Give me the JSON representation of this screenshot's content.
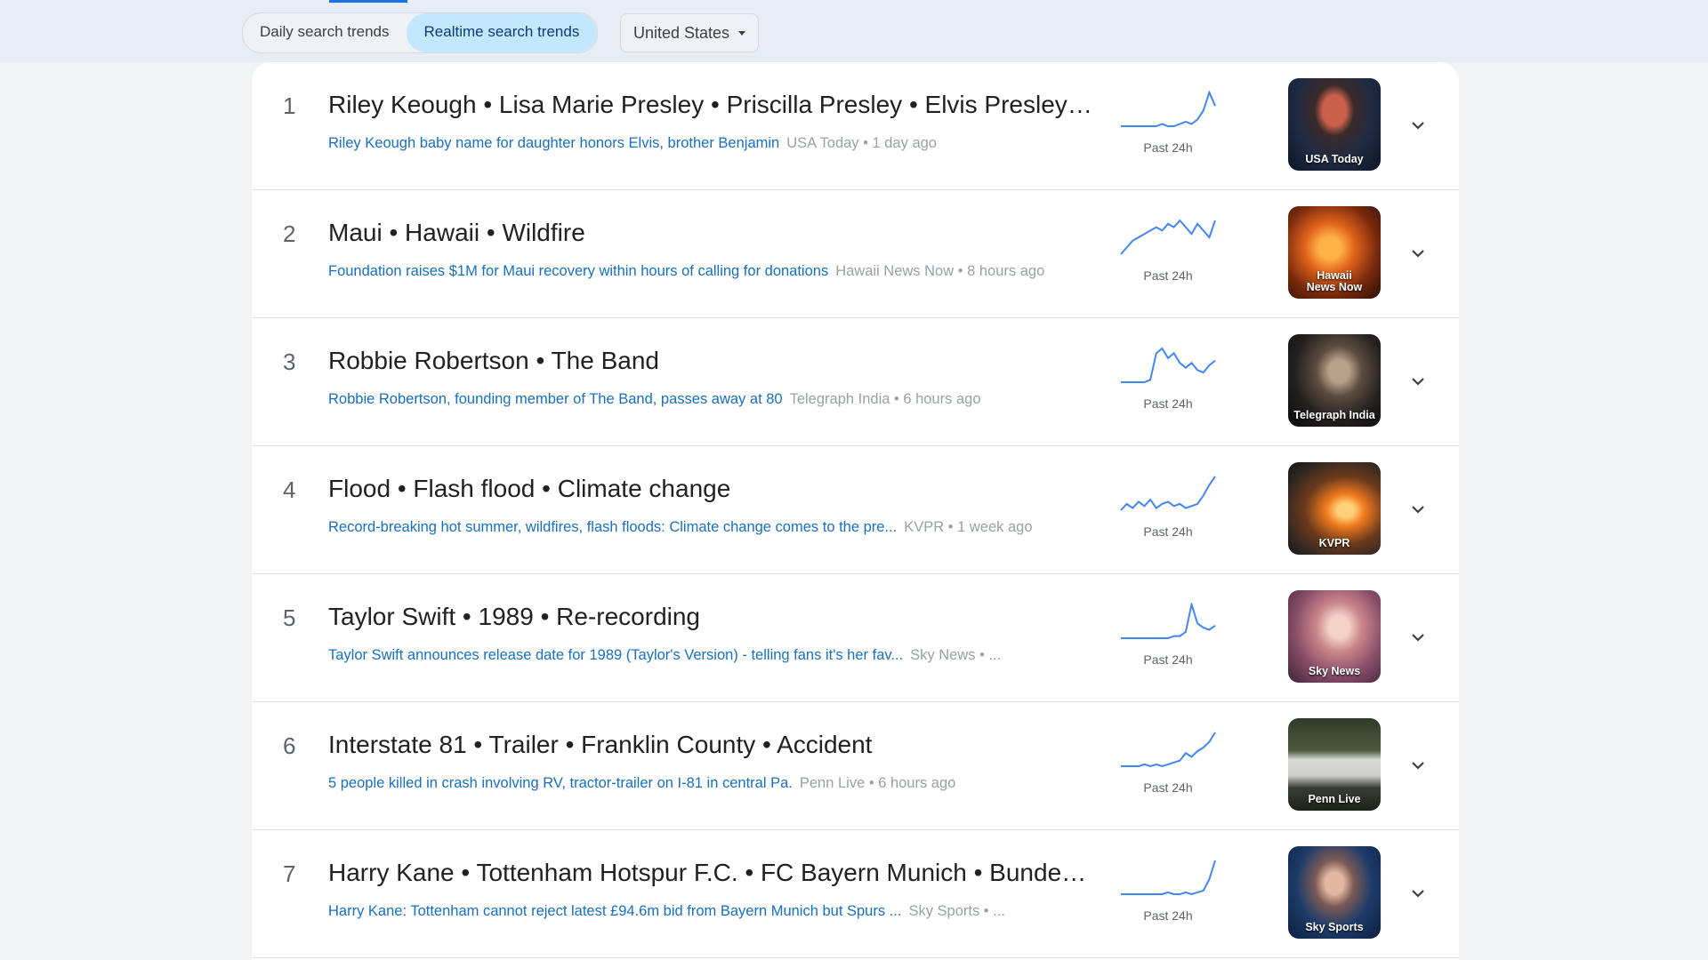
{
  "header": {
    "tabs": [
      {
        "label": "Daily search trends"
      },
      {
        "label": "Realtime search trends"
      }
    ],
    "country": "United States"
  },
  "trends": [
    {
      "rank": "1",
      "title": "Riley Keough • Lisa Marie Presley • Priscilla Presley • Elvis Presley • Graceland",
      "headline": "Riley Keough baby name for daughter honors Elvis, brother Benjamin",
      "meta": "USA Today • 1 day ago",
      "period": "Past 24h",
      "source": "USA Today",
      "trend": [
        3,
        3,
        3,
        3,
        3,
        3,
        3,
        4,
        3,
        3,
        4,
        5,
        4,
        6,
        10,
        18,
        12
      ]
    },
    {
      "rank": "2",
      "title": "Maui • Hawaii • Wildfire",
      "headline": "Foundation raises $1M for Maui recovery within hours of calling for donations",
      "meta": "Hawaii News Now • 8 hours ago",
      "period": "Past 24h",
      "source": "Hawaii News Now",
      "trend": [
        4,
        6,
        8,
        9,
        10,
        11,
        12,
        11,
        13,
        12,
        14,
        12,
        10,
        13,
        11,
        9,
        14
      ]
    },
    {
      "rank": "3",
      "title": "Robbie Robertson • The Band",
      "headline": "Robbie Robertson, founding member of The Band, passes away at 80",
      "meta": "Telegraph India • 6 hours ago",
      "period": "Past 24h",
      "source": "Telegraph India",
      "trend": [
        1,
        1,
        1,
        1,
        1,
        2,
        13,
        15,
        11,
        13,
        9,
        7,
        9,
        6,
        5,
        8,
        10
      ]
    },
    {
      "rank": "4",
      "title": "Flood • Flash flood • Climate change",
      "headline": "Record-breaking hot summer, wildfires, flash floods: Climate change comes to the pre...",
      "meta": "KVPR • 1 week ago",
      "period": "Past 24h",
      "source": "KVPR",
      "trend": [
        3,
        6,
        4,
        7,
        5,
        8,
        4,
        6,
        7,
        5,
        6,
        4,
        5,
        6,
        10,
        15,
        19
      ]
    },
    {
      "rank": "5",
      "title": "Taylor Swift • 1989 • Re-recording",
      "headline": "Taylor Swift announces release date for 1989 (Taylor's Version) - telling fans it's her fav...",
      "meta": "Sky News • ...",
      "period": "Past 24h",
      "source": "Sky News",
      "trend": [
        1,
        1,
        1,
        1,
        1,
        1,
        1,
        1,
        1,
        2,
        2,
        4,
        17,
        8,
        6,
        5,
        7
      ]
    },
    {
      "rank": "6",
      "title": "Interstate 81 • Trailer • Franklin County • Accident",
      "headline": "5 people killed in crash involving RV, tractor-trailer on I-81 in central Pa.",
      "meta": "Penn Live • 6 hours ago",
      "period": "Past 24h",
      "source": "Penn Live",
      "trend": [
        2,
        2,
        2,
        2,
        3,
        2,
        3,
        2,
        3,
        4,
        5,
        9,
        7,
        10,
        12,
        15,
        20
      ]
    },
    {
      "rank": "7",
      "title": "Harry Kane • Tottenham Hotspur F.C. • FC Bayern Munich • Bundesliga • Football",
      "headline": "Harry Kane: Tottenham cannot reject latest £94.6m bid from Bayern Munich but Spurs ...",
      "meta": "Sky Sports • ...",
      "period": "Past 24h",
      "source": "Sky Sports",
      "trend": [
        2,
        2,
        2,
        2,
        2,
        2,
        2,
        2,
        3,
        2,
        2,
        3,
        2,
        3,
        4,
        10,
        20
      ]
    }
  ],
  "colors": {
    "accent": "#1a73e8",
    "headline": "#1a6fbd",
    "spark": "#4285f4"
  }
}
